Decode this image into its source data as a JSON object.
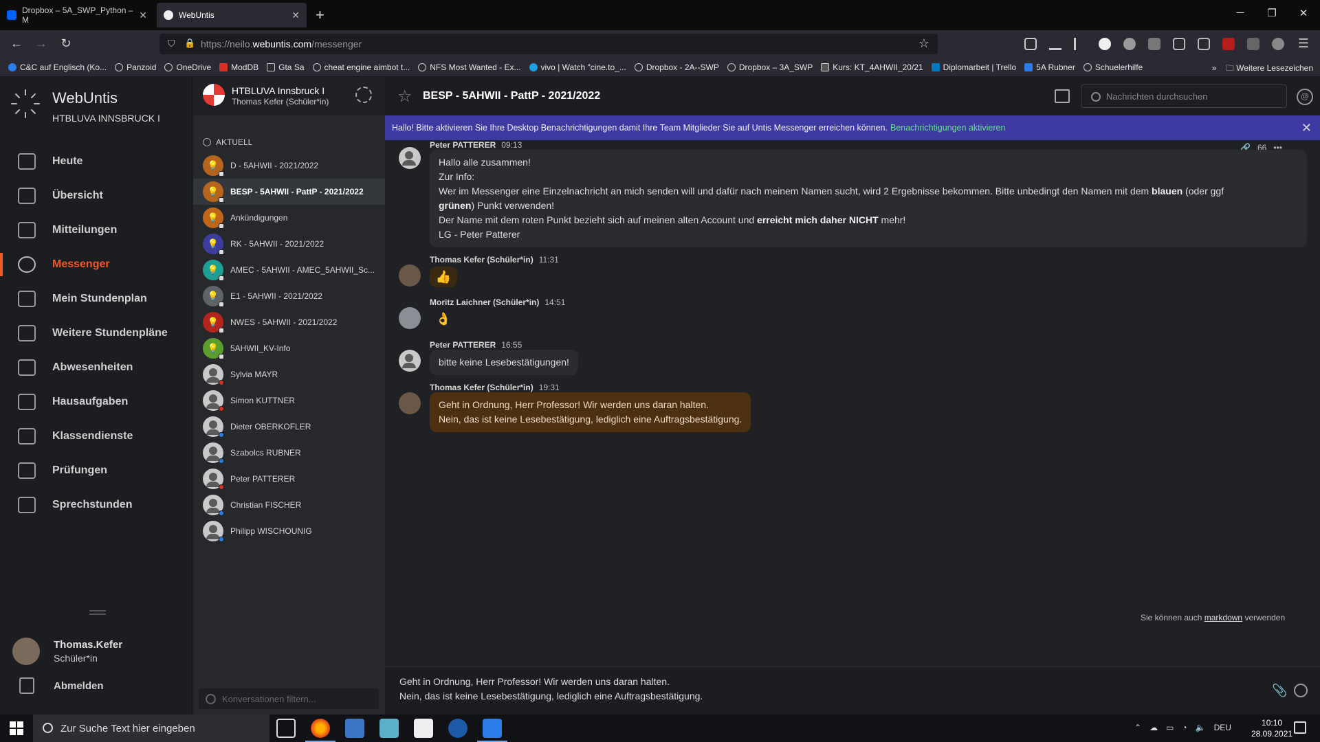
{
  "browser": {
    "tabs": [
      {
        "title": "Dropbox – 5A_SWP_Python – M"
      },
      {
        "title": "WebUntis"
      }
    ],
    "url_prefix": "https://neilo.",
    "url_domain": "webuntis.com",
    "url_path": "/messenger",
    "bookmarks": [
      "C&C auf Englisch (Ko...",
      "Panzoid",
      "OneDrive",
      "ModDB",
      "Gta Sa",
      "cheat engine aimbot t...",
      "NFS Most Wanted - Ex...",
      "vivo | Watch \"cine.to_...",
      "Dropbox - 2A--SWP",
      "Dropbox – 3A_SWP",
      "Kurs: KT_4AHWII_20/21",
      "Diplomarbeit | Trello",
      "5A Rubner",
      "Schuelerhilfe"
    ],
    "bookmarks_more": "Weitere Lesezeichen"
  },
  "app": {
    "brand": "WebUntis",
    "school": "HTBLUVA INNSBRUCK I",
    "nav": [
      "Heute",
      "Übersicht",
      "Mitteilungen",
      "Messenger",
      "Mein Stundenplan",
      "Weitere Stundenpläne",
      "Abwesenheiten",
      "Hausaufgaben",
      "Klassendienste",
      "Prüfungen",
      "Sprechstunden"
    ],
    "active_nav": "Messenger",
    "user": {
      "name": "Thomas.Kefer",
      "role": "Schüler*in"
    },
    "logout": "Abmelden"
  },
  "conversations": {
    "school_name": "HTBLUVA Innsbruck I",
    "school_user": "Thomas Kefer (Schüler*in)",
    "section": "AKTUELL",
    "items": [
      {
        "label": "D - 5AHWII - 2021/2022",
        "color": "#b5651d"
      },
      {
        "label": "BESP - 5AHWII - PattP - 2021/2022",
        "color": "#b5651d"
      },
      {
        "label": "Ankündigungen",
        "color": "#c0661a"
      },
      {
        "label": "RK - 5AHWII - 2021/2022",
        "color": "#3d3d9e"
      },
      {
        "label": "AMEC - 5AHWII - AMEC_5AHWII_Sc...",
        "color": "#1f9e94"
      },
      {
        "label": "E1 - 5AHWII - 2021/2022",
        "color": "#5f6368"
      },
      {
        "label": "NWES - 5AHWII - 2021/2022",
        "color": "#b3261e"
      },
      {
        "label": "5AHWII_KV-Info",
        "color": "#5c9e2e"
      },
      {
        "label": "Sylvia MAYR",
        "status": "#d93025"
      },
      {
        "label": "Simon KUTTNER",
        "status": "#d93025"
      },
      {
        "label": "Dieter OBERKOFLER",
        "status": "#2b7de9"
      },
      {
        "label": "Szabolcs RUBNER",
        "status": "#2b7de9"
      },
      {
        "label": "Peter PATTERER",
        "status": "#d93025"
      },
      {
        "label": "Christian FISCHER",
        "status": "#2b7de9"
      },
      {
        "label": "Philipp WISCHOUNIG",
        "status": "#2b7de9"
      }
    ],
    "selected": "BESP - 5AHWII - PattP - 2021/2022",
    "filter_placeholder": "Konversationen filtern..."
  },
  "chat": {
    "title": "BESP - 5AHWII - PattP - 2021/2022",
    "search_placeholder": "Nachrichten durchsuchen",
    "banner_text": "Hallo! Bitte aktivieren Sie Ihre Desktop Benachrichtigungen damit Ihre Team Mitglieder Sie auf Untis Messenger erreichen können.",
    "banner_link": "Benachrichtigungen aktivieren",
    "read_count": "66",
    "messages": [
      {
        "author": "Peter PATTERER",
        "time": "09:13",
        "line1": "Hallo alle zusammen!",
        "line2": "Zur Info:",
        "line3a": "Wer im Messenger eine Einzelnachricht an mich senden will und dafür nach meinem Namen sucht, wird 2 Ergebnisse bekommen. Bitte unbedingt den Namen mit dem ",
        "line3b": "blauen",
        "line3c": " (oder ggf ",
        "line4a": "grünen",
        "line4b": ") Punkt verwenden!",
        "line5a": "Der Name mit dem roten Punkt bezieht sich auf meinen alten Account und ",
        "line5b": "erreicht mich daher NICHT",
        "line5c": " mehr!",
        "line6": "LG - Peter Patterer"
      },
      {
        "author": "Thomas Kefer (Schüler*in)",
        "time": "11:31",
        "emoji": "👍"
      },
      {
        "author": "Moritz Laichner (Schüler*in)",
        "time": "14:51",
        "emoji": "👌"
      },
      {
        "author": "Peter PATTERER",
        "time": "16:55",
        "text": "bitte keine Lesebestätigungen!"
      },
      {
        "author": "Thomas Kefer (Schüler*in)",
        "time": "19:31",
        "line1": "Geht in Ordnung, Herr Professor! Wir werden uns daran halten.",
        "line2": "Nein, das ist keine Lesebestätigung, lediglich eine Auftragsbestätigung."
      }
    ],
    "markdown_hint_a": "Sie können auch ",
    "markdown_hint_link": "markdown",
    "markdown_hint_b": " verwenden",
    "composer_text": "Geht in Ordnung, Herr Professor! Wir werden uns daran halten.\nNein, das ist keine Lesebestätigung, lediglich eine Auftragsbestätigung."
  },
  "taskbar": {
    "search_placeholder": "Zur Suche Text hier eingeben",
    "lang": "DEU",
    "time": "10:10",
    "date": "28.09.2021"
  }
}
